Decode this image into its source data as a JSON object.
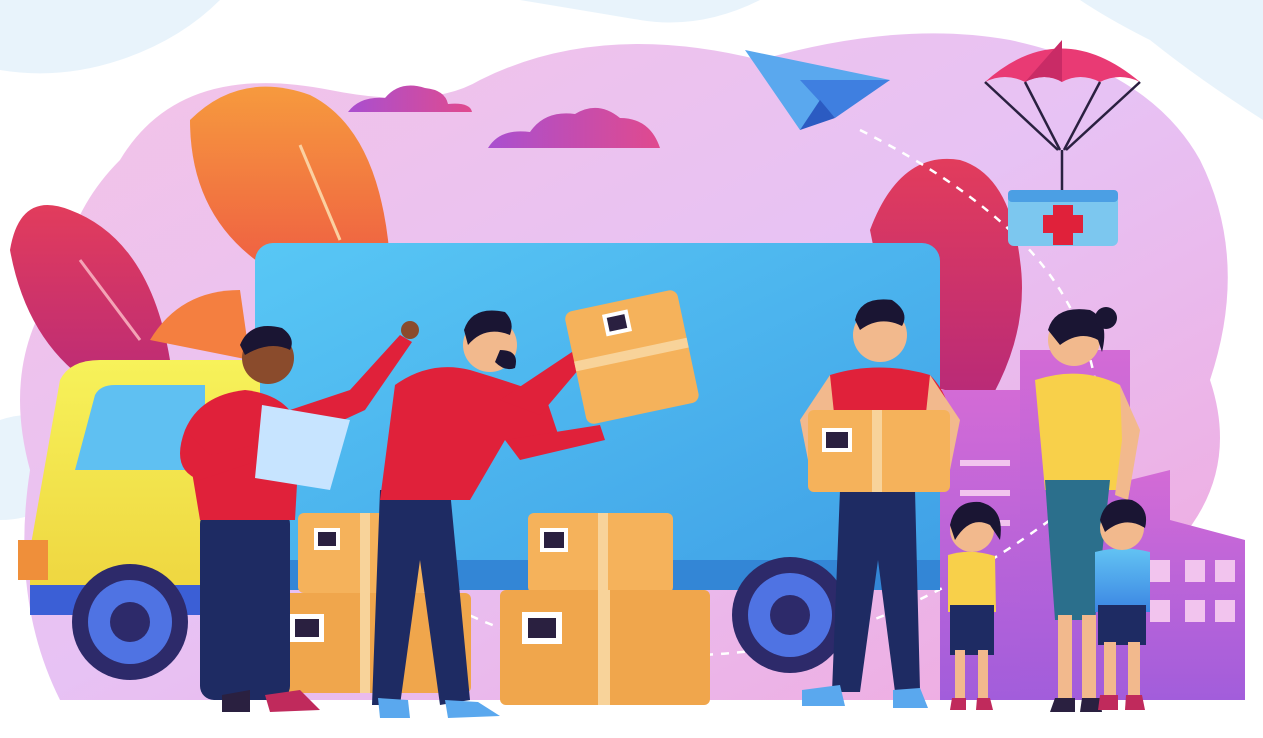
{
  "scene": {
    "type": "flat illustration",
    "colors": {
      "background": "#ffffff",
      "backdrop_pink": "#f1b3dc",
      "backdrop_lilac": "#e5c9f2",
      "truck_body": "#4fb3ee",
      "truck_cab": "#f4ef4e",
      "box": "#f5b25b",
      "box_shadow": "#e89a3e",
      "shirt_red": "#e0213a",
      "pants_navy": "#1e2b63",
      "parachute": "#e93a74",
      "medical_cross": "#e0213a",
      "leaf_orange": "#f68c3a",
      "leaf_red": "#d62f52",
      "cloud": "#c74bb4",
      "skyline": "#b45fd9"
    },
    "icons": [
      "paper-plane-icon",
      "parachute-icon",
      "medical-crate-icon",
      "barcode-icon"
    ]
  }
}
